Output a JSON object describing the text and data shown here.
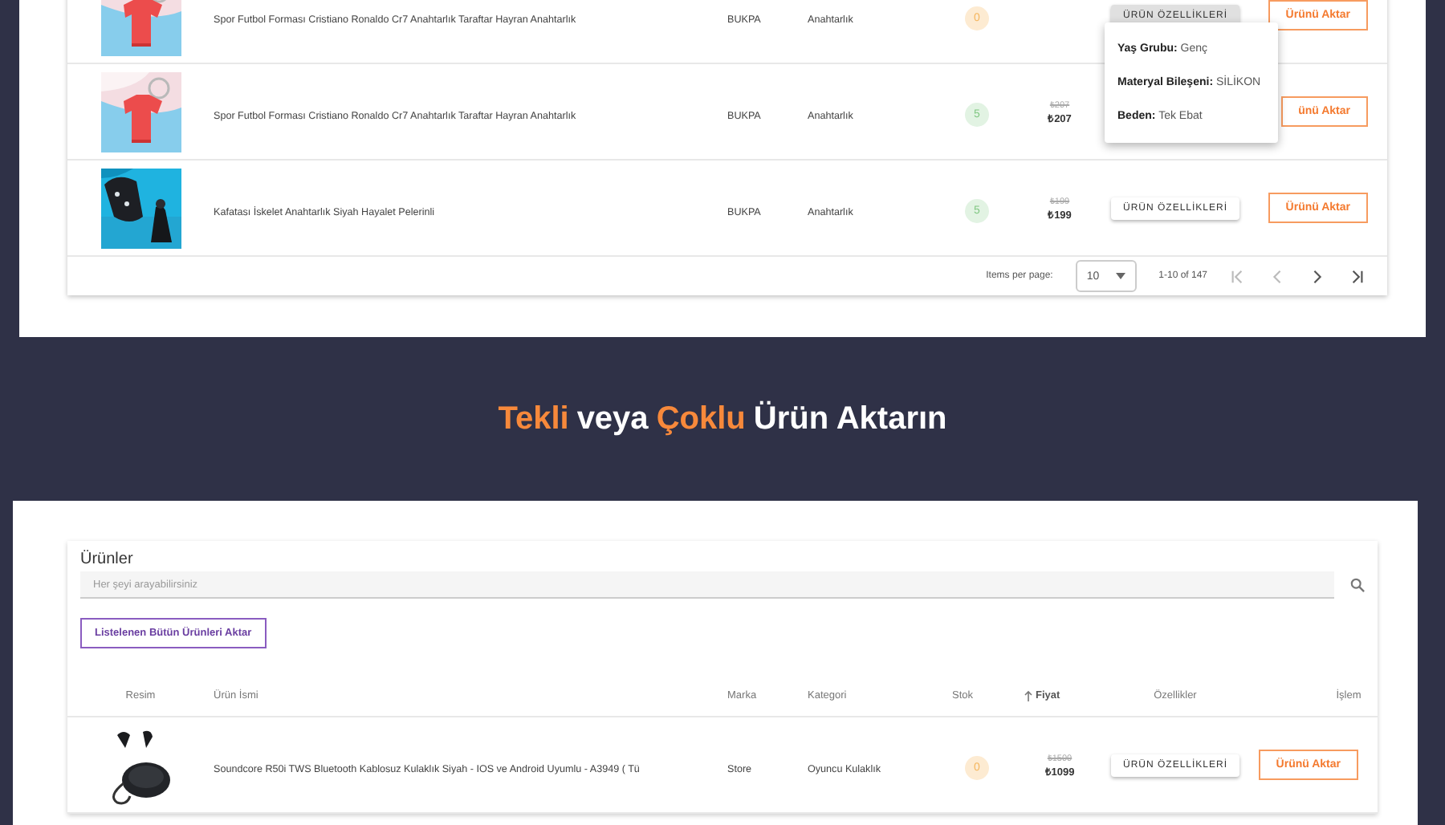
{
  "top_table": {
    "rows": [
      {
        "name": "Spor Futbol Forması Cristiano Ronaldo Cr7 Anahtarlık Taraftar Hayran Anahtarlık",
        "brand": "BUKPA",
        "category": "Anahtarlık",
        "stock": "0",
        "color": "#fdebd2",
        "features_button": {
          "label": "ÜRÜN ÖZELLİKLERİ",
          "active": true
        },
        "action": "Ürünü Aktar"
      },
      {
        "name": "Spor Futbol Forması Cristiano Ronaldo Cr7 Anahtarlık Taraftar Hayran Anahtarlık",
        "brand": "BUKPA",
        "category": "Anahtarlık",
        "stock": "5",
        "color": "#e2f3e3",
        "old_price": "₺207",
        "price": "₺207",
        "action": "ünü Aktar"
      },
      {
        "name": "Kafatası İskelet Anahtarlık Siyah Hayalet Pelerinli",
        "brand": "BUKPA",
        "category": "Anahtarlık",
        "stock": "5",
        "color": "#e2f3e3",
        "old_price": "₺199",
        "price": "₺199",
        "features_button": {
          "label": "ÜRÜN ÖZELLİKLERİ",
          "active": false
        },
        "action": "Ürünü Aktar"
      }
    ],
    "menu": [
      {
        "key": "Yaş Grubu:",
        "value": "Genç"
      },
      {
        "key": "Materyal Bileşeni:",
        "value": "SİLİKON"
      },
      {
        "key": "Beden:",
        "value": "Tek Ebat"
      }
    ],
    "pagination": {
      "label": "Items per page:",
      "page_size": "10",
      "range": "1-10 of 147"
    }
  },
  "heading": [
    {
      "text": "Tekli",
      "accent": true
    },
    {
      "text": "veya",
      "accent": false
    },
    {
      "text": "Çoklu",
      "accent": true
    },
    {
      "text": "Ürün Aktarın",
      "accent": false
    }
  ],
  "products": {
    "title": "Ürünler",
    "search": {
      "placeholder": "Her şeyi arayabilirsiniz"
    },
    "bulk_button": "Listelenen Bütün Ürünleri Aktar",
    "columns": [
      "Resim",
      "Ürün İsmi",
      "Marka",
      "Kategori",
      "Stok",
      "Fiyat",
      "Özellikler",
      "İşlem"
    ],
    "rows": [
      {
        "name": "Soundcore R50i TWS Bluetooth Kablosuz Kulaklık Siyah - IOS ve Android Uyumlu - A3949 ( Tü",
        "brand": "Store",
        "category": "Oyuncu Kulaklık",
        "stock": "0",
        "color": "#fdebd2",
        "old_price": "₺1500",
        "price": "₺1099",
        "features_button": {
          "label": "ÜRÜN ÖZELLİKLERİ",
          "active": false
        },
        "action": "Ürünü Aktar"
      }
    ]
  }
}
